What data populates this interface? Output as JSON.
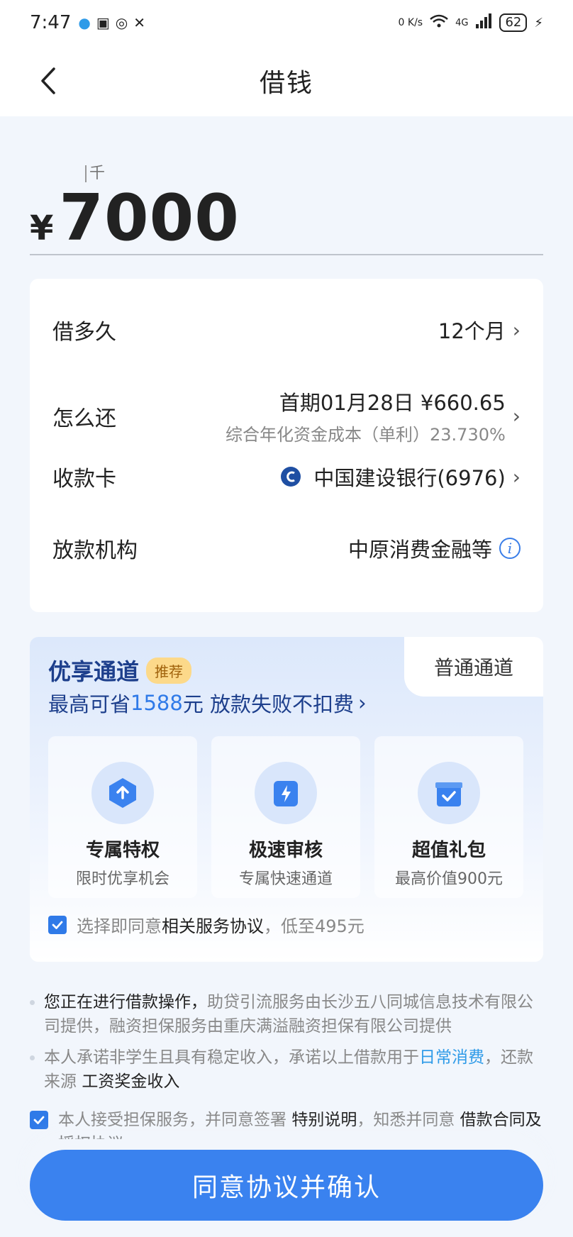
{
  "status_bar": {
    "time": "7:47",
    "net_speed": "0 K/s",
    "signal_label": "4G",
    "battery": "62"
  },
  "header": {
    "title": "借钱"
  },
  "amount": {
    "unit_hint": "千",
    "currency": "¥",
    "value": "7000"
  },
  "loan_details": {
    "term": {
      "label": "借多久",
      "value": "12个月"
    },
    "repay": {
      "label": "怎么还",
      "value": "首期01月28日 ¥660.65",
      "sub": "综合年化资金成本（单利）23.730%"
    },
    "card": {
      "label": "收款卡",
      "value": "中国建设银行(6976)"
    },
    "lender": {
      "label": "放款机构",
      "value": "中原消费金融等"
    }
  },
  "channel": {
    "premium_title": "优享通道",
    "badge": "推荐",
    "saving_prefix": "最高可省",
    "saving_amount": "1588",
    "saving_suffix": "元 放款失败不扣费",
    "normal_tab": "普通通道",
    "benefits": [
      {
        "title": "专属特权",
        "sub": "限时优享机会",
        "icon": "upload-badge-icon"
      },
      {
        "title": "极速审核",
        "sub": "专属快速通道",
        "icon": "lightning-card-icon"
      },
      {
        "title": "超值礼包",
        "sub": "最高价值900元",
        "icon": "gift-box-icon"
      }
    ],
    "agree_prefix": "选择即同意",
    "agree_link": "相关服务协议",
    "agree_suffix": "，低至495元"
  },
  "notes": {
    "note1_dark": "您正在进行借款操作，",
    "note1_rest": "助贷引流服务由长沙五八同城信息技术有限公司提供，融资担保服务由重庆满溢融资担保有限公司提供",
    "note2_a": "本人承诺非学生且具有稳定收入，承诺以上借款用于",
    "note2_purpose": "日常消费",
    "note2_b": "，还款来源 ",
    "note2_source": "工资奖金收入"
  },
  "guarantee": {
    "prefix": "本人接受担保服务，并同意签署 ",
    "link1": "特别说明",
    "mid": "，知悉并同意 ",
    "link2": "借款合同及授权协议"
  },
  "confirm_button": "同意协议并确认",
  "colors": {
    "accent": "#3a82ef",
    "premium_text": "#1d3f8c",
    "badge_bg": "#fcd98a"
  }
}
